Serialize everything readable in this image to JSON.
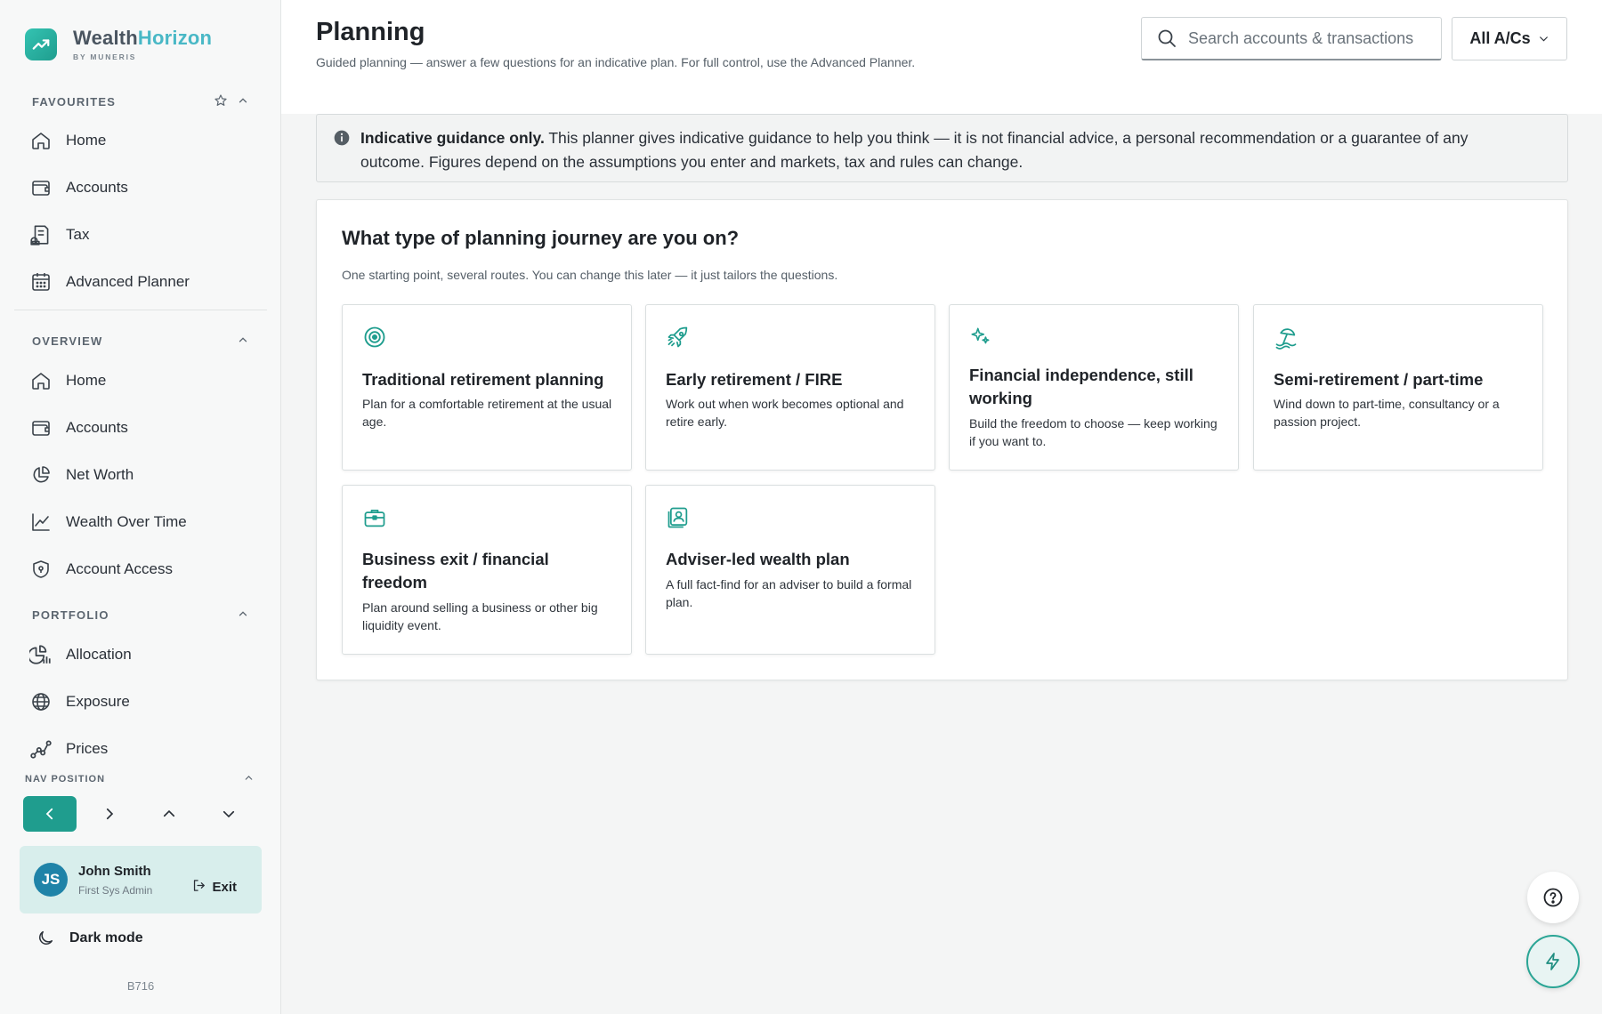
{
  "brand": {
    "name_part1": "Wealth",
    "name_part2": "Horizon",
    "sub": "BY MUNERIS"
  },
  "sidebar": {
    "favourites": {
      "title": "FAVOURITES",
      "items": [
        {
          "label": "Home",
          "icon": "home-icon"
        },
        {
          "label": "Accounts",
          "icon": "wallet-icon"
        },
        {
          "label": "Tax",
          "icon": "tax-icon"
        },
        {
          "label": "Advanced Planner",
          "icon": "calendar-icon"
        }
      ]
    },
    "overview": {
      "title": "OVERVIEW",
      "items": [
        {
          "label": "Home",
          "icon": "home-icon"
        },
        {
          "label": "Accounts",
          "icon": "wallet-icon"
        },
        {
          "label": "Net Worth",
          "icon": "pie-chart-icon"
        },
        {
          "label": "Wealth Over Time",
          "icon": "line-chart-icon"
        },
        {
          "label": "Account Access",
          "icon": "shield-icon"
        }
      ]
    },
    "portfolio": {
      "title": "PORTFOLIO",
      "items": [
        {
          "label": "Allocation",
          "icon": "allocation-icon"
        },
        {
          "label": "Exposure",
          "icon": "globe-icon"
        },
        {
          "label": "Prices",
          "icon": "prices-icon"
        }
      ]
    },
    "nav_position": {
      "title": "NAV POSITION"
    },
    "user": {
      "initials": "JS",
      "name": "John Smith",
      "role": "First Sys Admin",
      "exit_label": "Exit"
    },
    "dark_mode_label": "Dark mode",
    "build": "B716"
  },
  "header": {
    "title": "Planning",
    "subtitle": "Guided planning — answer a few questions for an indicative plan. For full control, use the Advanced Planner.",
    "search_placeholder": "Search accounts & transactions",
    "account_select": "All A/Cs"
  },
  "notice": {
    "bold": "Indicative guidance only.",
    "text": " This planner gives indicative guidance to help you think — it is not financial advice, a personal recommendation or a guarantee of any outcome. Figures depend on the assumptions you enter and markets, tax and rules can change."
  },
  "journey": {
    "title": "What type of planning journey are you on?",
    "subtitle": "One starting point, several routes. You can change this later — it just tailors the questions.",
    "cards": [
      {
        "icon": "target-icon",
        "title": "Traditional retirement planning",
        "desc": "Plan for a comfortable retirement at the usual age."
      },
      {
        "icon": "rocket-icon",
        "title": "Early retirement / FIRE",
        "desc": "Work out when work becomes optional and retire early."
      },
      {
        "icon": "sparkles-icon",
        "title": "Financial independence, still working",
        "desc": "Build the freedom to choose — keep working if you want to."
      },
      {
        "icon": "beach-icon",
        "title": "Semi-retirement / part-time",
        "desc": "Wind down to part-time, consultancy or a passion project."
      },
      {
        "icon": "briefcase-icon",
        "title": "Business exit / financial freedom",
        "desc": "Plan around selling a business or other big liquidity event."
      },
      {
        "icon": "adviser-icon",
        "title": "Adviser-led wealth plan",
        "desc": "A full fact-find for an adviser to build a formal plan."
      }
    ]
  },
  "colors": {
    "accent": "#1f9d8e",
    "brand_accent": "#49b8c6",
    "avatar": "#1f83a8"
  }
}
